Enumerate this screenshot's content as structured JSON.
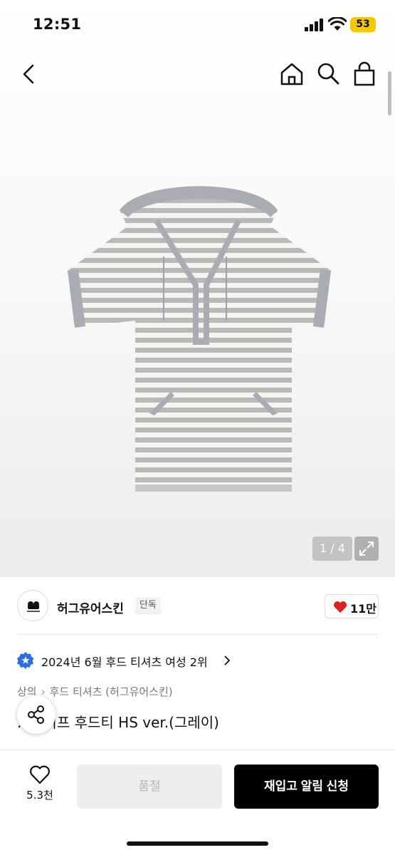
{
  "status_bar": {
    "time": "12:51",
    "battery": "53"
  },
  "nav": {
    "back": "back",
    "home": "home",
    "search": "search",
    "cart": "cart"
  },
  "gallery": {
    "counter": "1 / 4",
    "current": 1,
    "total": 4
  },
  "brand": {
    "name": "허그유어스킨",
    "badge": "단독",
    "likes": "11만"
  },
  "ranking": {
    "text": "2024년 6월 후드 티셔츠 여성 2위"
  },
  "breadcrumb": {
    "items": [
      "상의",
      "후드 티셔츠 (허그유어스킨)"
    ]
  },
  "product": {
    "title": "...라이프 후드티 HS ver.(그레이)"
  },
  "bottom_bar": {
    "wish_count": "5.3천",
    "soldout_label": "품절",
    "restock_label": "재입고 알림 신청"
  },
  "colors": {
    "accent": "#000000",
    "heart": "#e02020",
    "battery": "#f5c800",
    "rank_badge": "#2a6de8"
  }
}
